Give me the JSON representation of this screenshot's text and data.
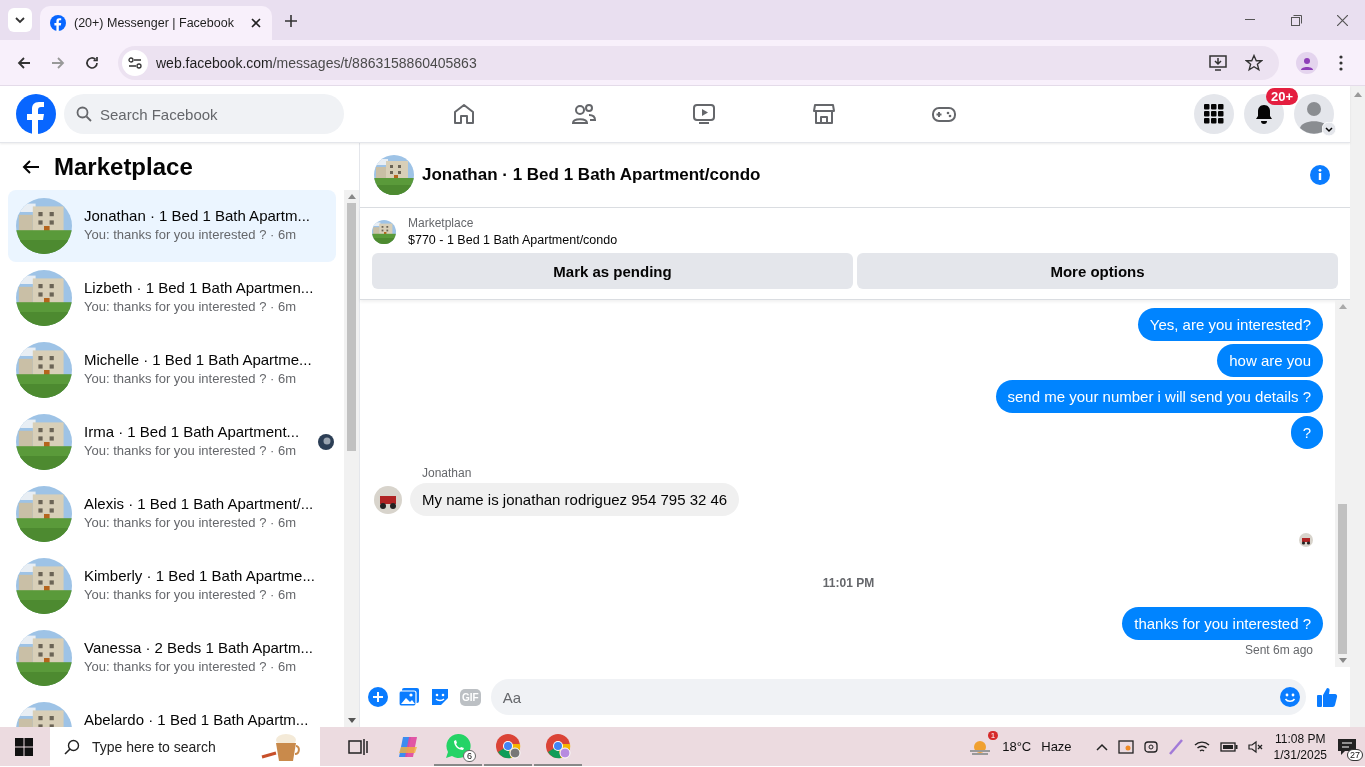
{
  "browser": {
    "tab_title": "(20+) Messenger | Facebook",
    "url_host": "web.facebook.com",
    "url_path": "/messages/t/8863158860405863"
  },
  "header": {
    "search_placeholder": "Search Facebook",
    "notification_badge": "20+"
  },
  "sidebar": {
    "title": "Marketplace",
    "conversations": [
      {
        "name": "Jonathan · 1 Bed 1 Bath Apartm...",
        "preview": "You: thanks for you interested ? · 6m",
        "selected": true,
        "seen": false
      },
      {
        "name": "Lizbeth · 1 Bed 1 Bath Apartmen...",
        "preview": "You: thanks for you interested ? · 6m",
        "selected": false,
        "seen": false
      },
      {
        "name": "Michelle · 1 Bed 1 Bath Apartme...",
        "preview": "You: thanks for you interested ? · 6m",
        "selected": false,
        "seen": false
      },
      {
        "name": "Irma · 1 Bed 1 Bath Apartment...",
        "preview": "You: thanks for you interested ? · 6m",
        "selected": false,
        "seen": true
      },
      {
        "name": "Alexis · 1 Bed 1 Bath Apartment/...",
        "preview": "You: thanks for you interested ? · 6m",
        "selected": false,
        "seen": false
      },
      {
        "name": "Kimberly · 1 Bed 1 Bath Apartme...",
        "preview": "You: thanks for you interested ? · 6m",
        "selected": false,
        "seen": false
      },
      {
        "name": "Vanessa · 2 Beds 1 Bath Apartm...",
        "preview": "You: thanks for you interested ? · 6m",
        "selected": false,
        "seen": false
      },
      {
        "name": "Abelardo · 1 Bed 1 Bath Apartm...",
        "selected": false,
        "seen": false
      }
    ]
  },
  "chat": {
    "title": "Jonathan · 1 Bed 1 Bath Apartment/condo",
    "listing_label": "Marketplace",
    "listing": "$770 - 1 Bed 1 Bath Apartment/condo",
    "buttons": [
      "Mark as pending",
      "More options"
    ],
    "messages": [
      {
        "kind": "out",
        "text": "Yes, are you interested?"
      },
      {
        "kind": "out",
        "text": "how are you"
      },
      {
        "kind": "out",
        "text": "send me your number i will send you details ?"
      },
      {
        "kind": "out",
        "text": "?"
      },
      {
        "kind": "in",
        "sender": "Jonathan",
        "text": "My name is jonathan rodriguez 954 795 32 46"
      },
      {
        "kind": "seen"
      },
      {
        "kind": "time",
        "text": "11:01 PM"
      },
      {
        "kind": "out",
        "text": "thanks for you interested ?"
      },
      {
        "kind": "status",
        "text": "Sent 6m ago"
      }
    ],
    "composer": {
      "gif_label": "GIF",
      "placeholder": "Aa"
    }
  },
  "taskbar": {
    "search_placeholder": "Type here to search",
    "whatsapp_badge": "6",
    "weather_badge": "1",
    "temperature": "18°C",
    "weather": "Haze",
    "time": "11:08 PM",
    "date": "1/31/2025",
    "notifications": "27"
  }
}
